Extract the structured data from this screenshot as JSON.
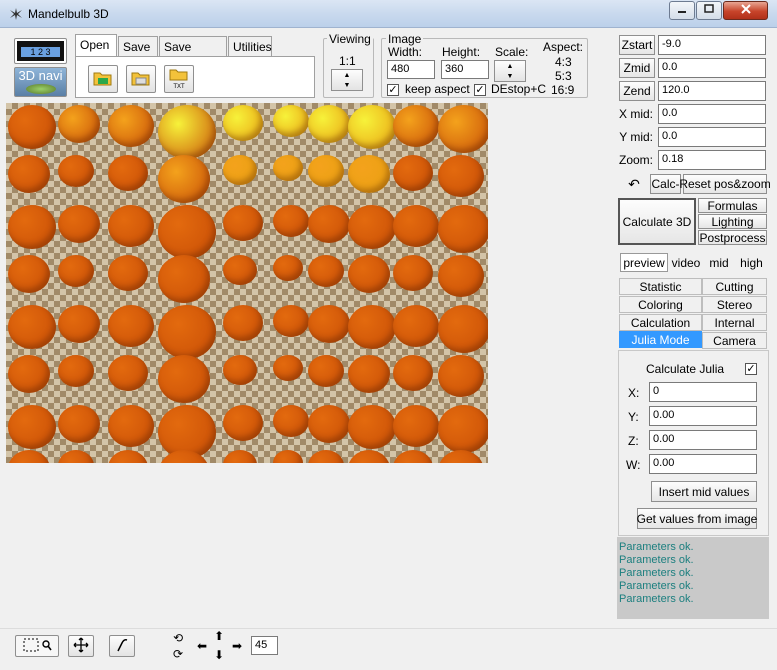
{
  "window": {
    "title": "Mandelbulb 3D",
    "icon": "spider-icon"
  },
  "toolbar": {
    "tabs": [
      {
        "label": "Open",
        "active": true
      },
      {
        "label": "Save",
        "active": false
      },
      {
        "label": "Save image",
        "active": false
      },
      {
        "label": "Utilities",
        "active": false
      }
    ],
    "navi_label": "3D navi",
    "animation_label": "1 2 3",
    "open_buttons": [
      "open-image-icon",
      "open-parameter-icon",
      "open-txt-icon"
    ],
    "open_txt_caption": "TXT",
    "viewing": {
      "label": "Viewing",
      "value": "1:1"
    },
    "image": {
      "label": "Image",
      "width_label": "Width:",
      "width": "480",
      "height_label": "Height:",
      "height": "360",
      "scale_label": "Scale:",
      "aspect_label": "Aspect:",
      "aspects": [
        "4:3",
        "5:3",
        "16:9"
      ],
      "keep_aspect_label": "keep aspect",
      "keep_aspect_checked": true,
      "destop_label": "DEstop+C",
      "destop_checked": true
    }
  },
  "params": {
    "zstart_label": "Zstart",
    "zstart": "-9.0",
    "zmid_label": "Zmid",
    "zmid": "0.0",
    "zend_label": "Zend",
    "zend": "120.0",
    "xmid_label": "X mid:",
    "xmid": "0.0",
    "ymid_label": "Y mid:",
    "ymid": "0.0",
    "zoom_label": "Zoom:",
    "zoom": "0.18"
  },
  "actions": {
    "calc_label": "Calc-",
    "reset_label": "Reset pos&zoom",
    "calculate3d_label": "Calculate 3D",
    "formulas_label": "Formulas",
    "lighting_label": "Lighting",
    "postprocess_label": "Postprocess"
  },
  "quality_tabs": [
    {
      "label": "preview",
      "selected": true
    },
    {
      "label": "video",
      "selected": false
    },
    {
      "label": "mid",
      "selected": false
    },
    {
      "label": "high",
      "selected": false
    }
  ],
  "panel_tabs": [
    [
      "Statistic",
      "Cutting"
    ],
    [
      "Coloring",
      "Stereo"
    ],
    [
      "Calculation",
      "Internal"
    ],
    [
      "Julia Mode",
      "Camera"
    ]
  ],
  "selected_panel_tab": "Julia Mode",
  "julia": {
    "calculate_label": "Calculate Julia",
    "calculate_checked": true,
    "x_label": "X:",
    "x": "0",
    "y_label": "Y:",
    "y": "0.00",
    "z_label": "Z:",
    "z": "0.00",
    "w_label": "W:",
    "w": "0.00",
    "insert_mid_label": "Insert mid values",
    "get_values_label": "Get values from image"
  },
  "log": [
    "Parameters ok.",
    "Parameters ok.",
    "Parameters ok.",
    "Parameters ok.",
    "Parameters ok."
  ],
  "bottom": {
    "angle_value": "45"
  },
  "colors": {
    "selected_tab": "#3399ff",
    "log_text": "#1c7f7f",
    "log_bg": "#c9c9c9"
  }
}
